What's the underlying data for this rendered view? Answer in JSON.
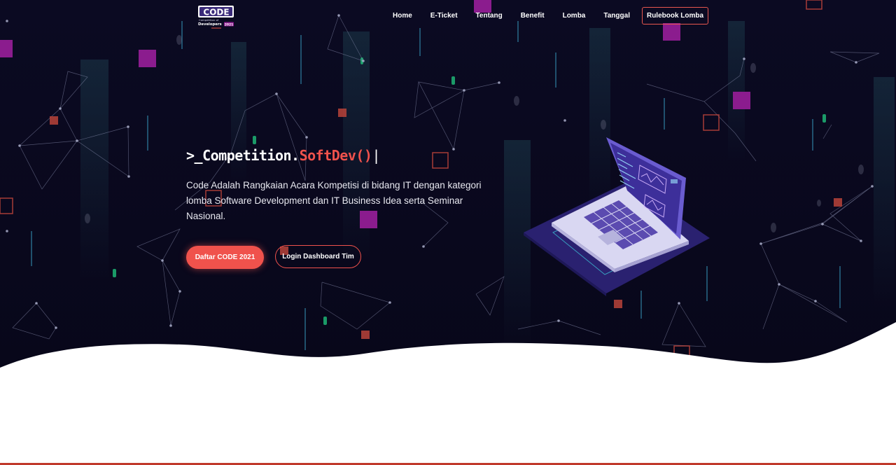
{
  "logo": {
    "word": "CODE",
    "line1": "Competition of",
    "line2": "Developers",
    "year": "2021"
  },
  "nav": {
    "items": [
      "Home",
      "E-Ticket",
      "Tentang",
      "Benefit",
      "Lomba",
      "Tanggal"
    ],
    "rulebook_label": "Rulebook Lomba"
  },
  "hero": {
    "headline_prefix": ">_Competition.",
    "headline_accent": "SoftDev()",
    "headline_cursor": "|",
    "description": "Code Adalah Rangkaian Acara Kompetisi di bidang IT dengan kategori lomba Software Development dan IT Business Idea serta Seminar Nasional.",
    "primary_button": "Daftar CODE 2021",
    "secondary_button": "Login Dashboard Tim"
  },
  "colors": {
    "background": "#0b0a22",
    "accent": "#f0524c",
    "purple": "#8b1c8e",
    "laptop_purple": "#4a3ca8"
  },
  "icons": {
    "logo": "code-logo",
    "illustration": "laptop-illustration"
  }
}
